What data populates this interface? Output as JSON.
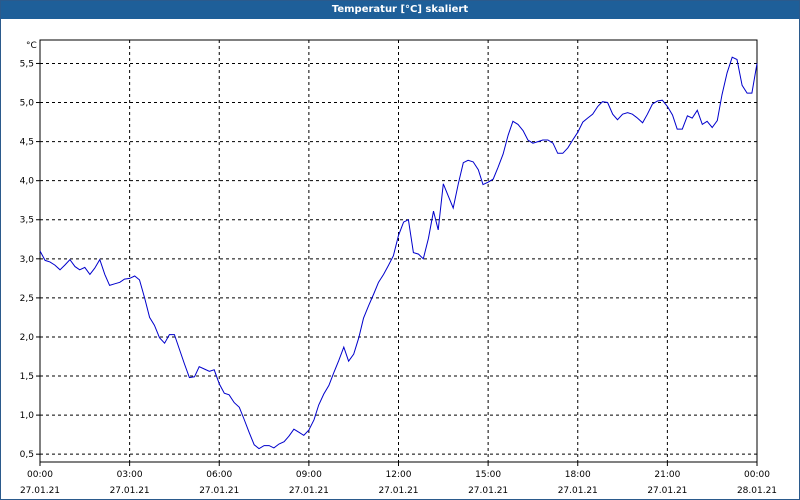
{
  "window": {
    "title": "Temperatur [°C] skaliert"
  },
  "chart_data": {
    "type": "line",
    "ylabel": "°C",
    "ylim": [
      0.4,
      5.8
    ],
    "grid": true,
    "yticks": [
      0.5,
      1.0,
      1.5,
      2.0,
      2.5,
      3.0,
      3.5,
      4.0,
      4.5,
      5.0,
      5.5
    ],
    "ytick_labels": [
      "0,5",
      "1,0",
      "1,5",
      "2,0",
      "2,5",
      "3,0",
      "3,5",
      "4,0",
      "4,5",
      "5,0",
      "5,5"
    ],
    "xlim": [
      0,
      24
    ],
    "xticks": [
      0,
      3,
      6,
      9,
      12,
      15,
      18,
      21,
      24
    ],
    "xtick_labels": [
      {
        "time": "00:00",
        "date": "27.01.21"
      },
      {
        "time": "03:00",
        "date": "27.01.21"
      },
      {
        "time": "06:00",
        "date": "27.01.21"
      },
      {
        "time": "09:00",
        "date": "27.01.21"
      },
      {
        "time": "12:00",
        "date": "27.01.21"
      },
      {
        "time": "15:00",
        "date": "27.01.21"
      },
      {
        "time": "18:00",
        "date": "27.01.21"
      },
      {
        "time": "21:00",
        "date": "27.01.21"
      },
      {
        "time": "00:00",
        "date": "28.01.21"
      }
    ],
    "series": [
      {
        "color": "#0000cc",
        "x": [
          0.0,
          0.17,
          0.33,
          0.5,
          0.67,
          0.83,
          1.0,
          1.17,
          1.33,
          1.5,
          1.67,
          1.83,
          2.0,
          2.17,
          2.33,
          2.5,
          2.67,
          2.83,
          3.0,
          3.17,
          3.33,
          3.5,
          3.67,
          3.83,
          4.0,
          4.17,
          4.33,
          4.5,
          4.67,
          4.83,
          5.0,
          5.17,
          5.33,
          5.5,
          5.67,
          5.83,
          6.0,
          6.17,
          6.33,
          6.5,
          6.67,
          6.83,
          7.0,
          7.17,
          7.33,
          7.5,
          7.67,
          7.83,
          8.0,
          8.17,
          8.33,
          8.5,
          8.67,
          8.83,
          9.0,
          9.17,
          9.33,
          9.5,
          9.67,
          9.83,
          10.0,
          10.17,
          10.33,
          10.5,
          10.67,
          10.83,
          11.0,
          11.17,
          11.33,
          11.5,
          11.67,
          11.83,
          12.0,
          12.17,
          12.33,
          12.5,
          12.67,
          12.83,
          13.0,
          13.17,
          13.33,
          13.5,
          13.67,
          13.83,
          14.0,
          14.17,
          14.33,
          14.5,
          14.67,
          14.83,
          15.0,
          15.17,
          15.33,
          15.5,
          15.67,
          15.83,
          16.0,
          16.17,
          16.33,
          16.5,
          16.67,
          16.83,
          17.0,
          17.17,
          17.33,
          17.5,
          17.67,
          17.83,
          18.0,
          18.17,
          18.33,
          18.5,
          18.67,
          18.83,
          19.0,
          19.17,
          19.33,
          19.5,
          19.67,
          19.83,
          20.0,
          20.17,
          20.33,
          20.5,
          20.67,
          20.83,
          21.0,
          21.17,
          21.33,
          21.5,
          21.67,
          21.83,
          22.0,
          22.17,
          22.33,
          22.5,
          22.67,
          22.83,
          23.0,
          23.17,
          23.33,
          23.5,
          23.67,
          23.83,
          24.0
        ],
        "y": [
          3.1,
          2.98,
          2.96,
          2.92,
          2.86,
          2.92,
          2.99,
          2.9,
          2.86,
          2.89,
          2.8,
          2.88,
          2.99,
          2.8,
          2.66,
          2.68,
          2.7,
          2.74,
          2.75,
          2.78,
          2.73,
          2.5,
          2.25,
          2.15,
          1.99,
          1.92,
          2.03,
          2.03,
          1.84,
          1.66,
          1.48,
          1.49,
          1.62,
          1.59,
          1.56,
          1.58,
          1.4,
          1.28,
          1.26,
          1.16,
          1.1,
          0.95,
          0.78,
          0.62,
          0.57,
          0.61,
          0.61,
          0.58,
          0.63,
          0.66,
          0.73,
          0.82,
          0.78,
          0.74,
          0.81,
          0.94,
          1.13,
          1.27,
          1.38,
          1.54,
          1.7,
          1.87,
          1.69,
          1.78,
          1.99,
          2.24,
          2.4,
          2.55,
          2.7,
          2.8,
          2.92,
          3.04,
          3.3,
          3.47,
          3.5,
          3.08,
          3.06,
          3.0,
          3.26,
          3.61,
          3.37,
          3.96,
          3.8,
          3.65,
          3.96,
          4.23,
          4.26,
          4.24,
          4.14,
          3.95,
          3.98,
          4.02,
          4.17,
          4.34,
          4.58,
          4.76,
          4.72,
          4.64,
          4.52,
          4.48,
          4.5,
          4.52,
          4.52,
          4.48,
          4.35,
          4.35,
          4.42,
          4.52,
          4.62,
          4.75,
          4.8,
          4.85,
          4.95,
          5.01,
          5.0,
          4.85,
          4.78,
          4.85,
          4.87,
          4.85,
          4.8,
          4.74,
          4.85,
          4.98,
          5.02,
          5.03,
          4.95,
          4.84,
          4.66,
          4.66,
          4.83,
          4.8,
          4.9,
          4.72,
          4.76,
          4.68,
          4.77,
          5.1,
          5.38,
          5.58,
          5.55,
          5.22,
          5.12,
          5.12,
          5.5
        ]
      }
    ]
  }
}
